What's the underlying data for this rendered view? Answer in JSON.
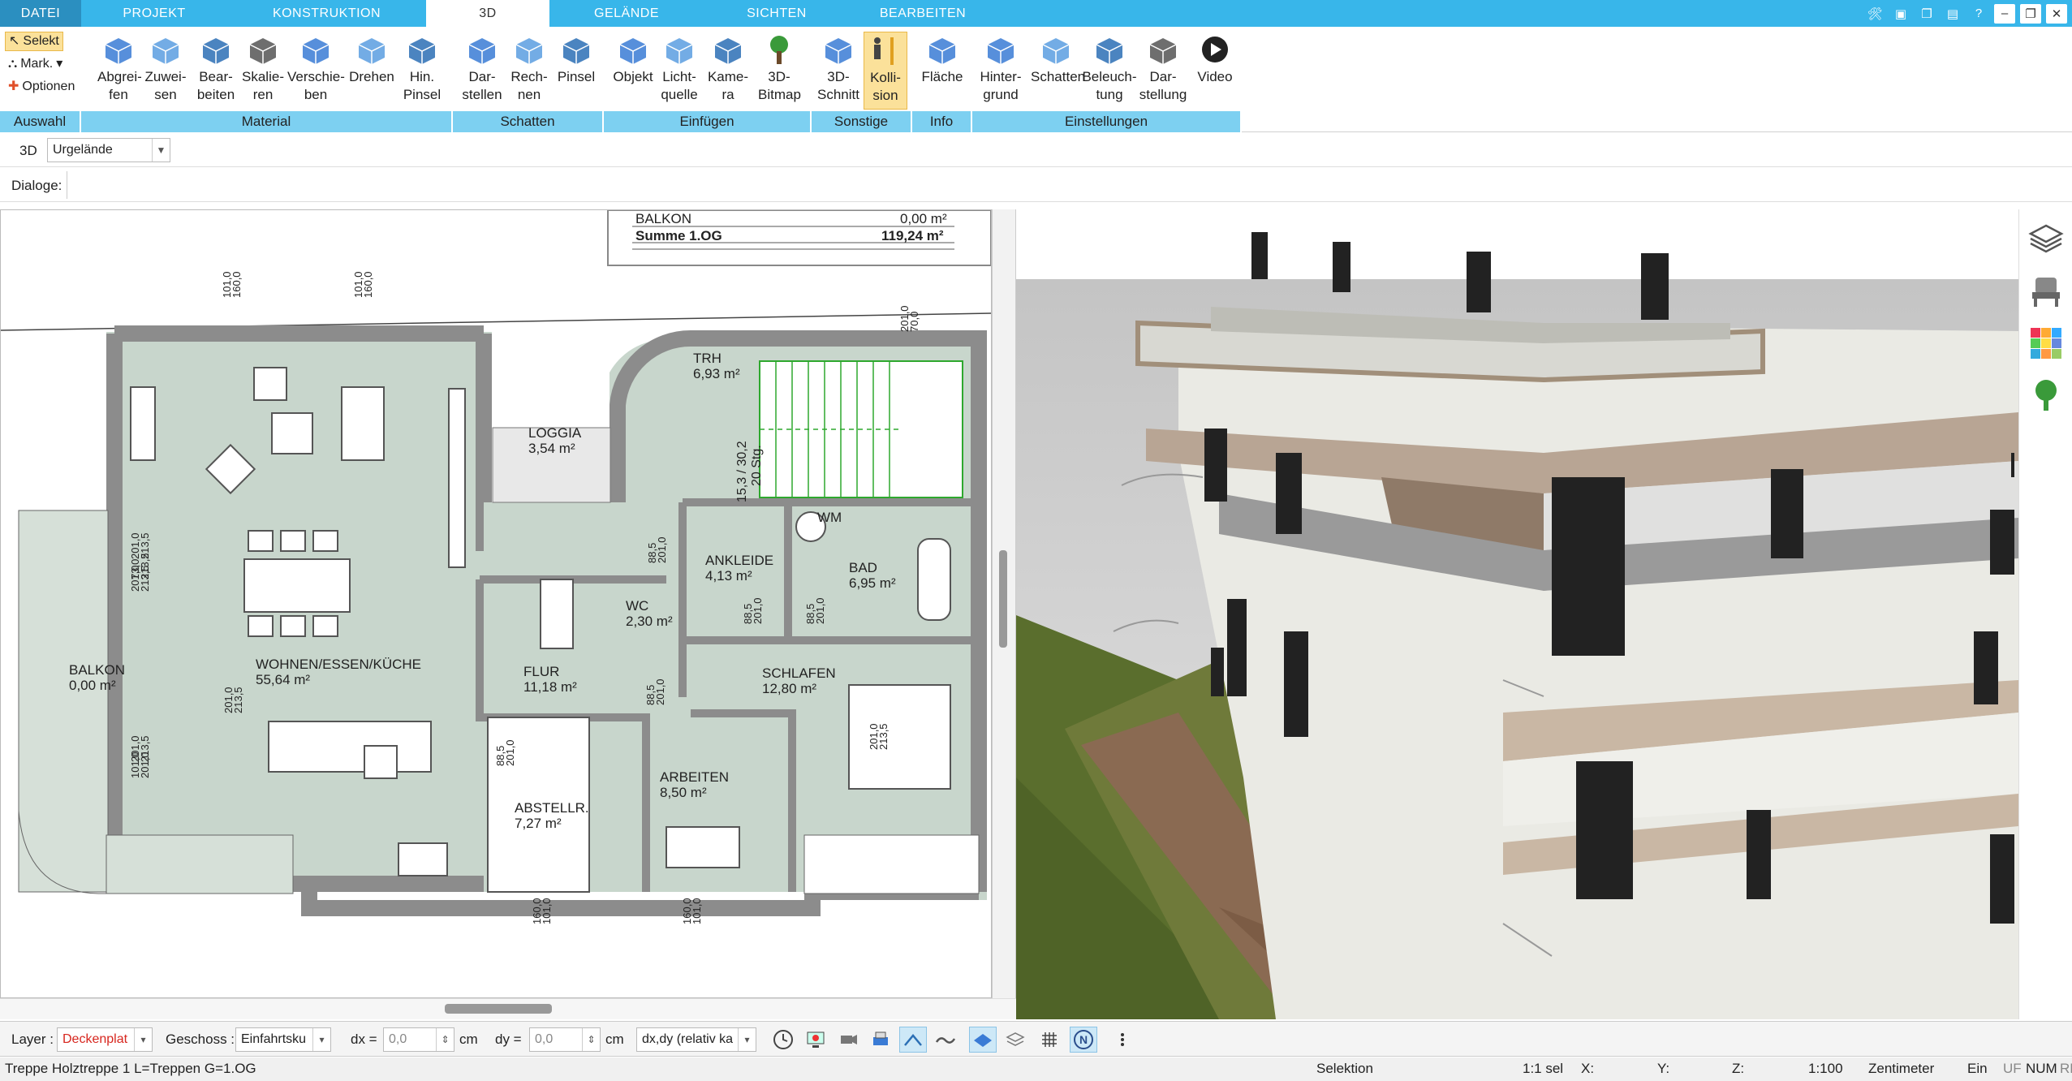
{
  "menu_tabs": [
    "DATEI",
    "PROJEKT",
    "KONSTRUKTION",
    "3D",
    "GELÄNDE",
    "SICHTEN",
    "BEARBEITEN"
  ],
  "active_tab": "3D",
  "ribbon": {
    "auswahl": {
      "label": "Auswahl",
      "selekt": "Selekt",
      "mark": "Mark.",
      "optionen": "Optionen"
    },
    "material": {
      "label": "Material",
      "buttons": [
        "Abgrei-\nfen",
        "Zuwei-\nsen",
        "Bear-\nbeiten",
        "Skalie-\nren",
        "Verschie-\nben",
        "Drehen",
        "Hin.\nPinsel"
      ]
    },
    "schatten": {
      "label": "Schatten",
      "buttons": [
        "Dar-\nstellen",
        "Rech-\nnen",
        "Pinsel"
      ]
    },
    "einfuegen": {
      "label": "Einfügen",
      "buttons": [
        "Objekt",
        "Licht-\nquelle",
        "Kame-\nra",
        "3D-\nBitmap"
      ]
    },
    "sonstige": {
      "label": "Sonstige",
      "buttons": [
        "3D-\nSchnitt",
        "Kolli-\nsion"
      ]
    },
    "info": {
      "label": "Info",
      "buttons": [
        "Fläche"
      ]
    },
    "einstellungen": {
      "label": "Einstellungen",
      "buttons": [
        "Hinter-\ngrund",
        "Schatten",
        "Beleuch-\ntung",
        "Dar-\nstellung",
        "Video"
      ]
    }
  },
  "row2": {
    "mode": "3D",
    "dropdown": "Urgelände"
  },
  "row3": {
    "label": "Dialoge:"
  },
  "plan": {
    "table": {
      "row1_label": "BALKON",
      "row1_value": "0,00  m²",
      "row2_label": "Summe 1.OG",
      "row2_value": "119,24 m²"
    },
    "rooms": [
      {
        "name": "LOGGIA",
        "area": "3,54 m²"
      },
      {
        "name": "TRH",
        "area": "6,93 m²"
      },
      {
        "name": "WM",
        "area": ""
      },
      {
        "name": "ANKLEIDE",
        "area": "4,13 m²"
      },
      {
        "name": "BAD",
        "area": "6,95 m²"
      },
      {
        "name": "WC",
        "area": "2,30 m²"
      },
      {
        "name": "BALKON",
        "area": "0,00 m²"
      },
      {
        "name": "WOHNEN/ESSEN/KÜCHE",
        "area": "55,64 m²"
      },
      {
        "name": "FLUR",
        "area": "11,18 m²"
      },
      {
        "name": "SCHLAFEN",
        "area": "12,80 m²"
      },
      {
        "name": "ARBEITEN",
        "area": "8,50 m²"
      },
      {
        "name": "ABSTELLR.",
        "area": "7,27 m²"
      }
    ],
    "stair_label": "15,3 / 30,2",
    "stair_steps": "20 Stg.",
    "dims": [
      "101,0",
      "160,0",
      "101,0",
      "160,0",
      "201,0",
      "70,0",
      "201,0",
      "213,5",
      "73,0",
      "213,5",
      "201,0",
      "213,5",
      "201,0",
      "213,5",
      "101,0",
      "201,0",
      "88,5",
      "201,0",
      "88,5",
      "201,0",
      "88,5",
      "201,0",
      "88,5",
      "201,0",
      "88,5",
      "201,0",
      "201,0",
      "213,5",
      "160,0",
      "101,0",
      "160,0",
      "101,0",
      "201,0",
      "213,5"
    ]
  },
  "statusbar": {
    "layer_label": "Layer :",
    "layer_value": "Deckenplat",
    "geschoss_label": "Geschoss :",
    "geschoss_value": "Einfahrtsku",
    "dx_label": "dx =",
    "dx_value": "0,0",
    "dx_unit": "cm",
    "dy_label": "dy =",
    "dy_value": "0,0",
    "dy_unit": "cm",
    "mode_value": "dx,dy (relativ ka"
  },
  "bottom": {
    "left_text": "Treppe Holztreppe 1 L=Treppen G=1.OG",
    "selektion": "Selektion",
    "sel_count": "1:1 sel",
    "x": "X:",
    "y": "Y:",
    "z": "Z:",
    "scale": "1:100",
    "unit": "Zentimeter",
    "ein": "Ein",
    "uf": "UF",
    "num": "NUM",
    "rf": "RF"
  },
  "colors": {
    "accent": "#38b6ea",
    "group_label_bg": "#7dd0f1",
    "active_button": "#fbe19a",
    "plan_fill": "#c8d6cc",
    "wall": "#8c8c8c",
    "stair_green": "#2ea82e",
    "layer_red": "#d7261e"
  }
}
